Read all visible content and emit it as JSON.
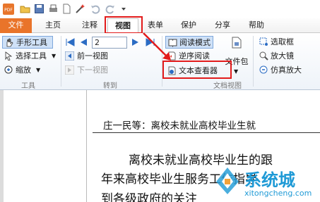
{
  "qat": {
    "icons": [
      "pdf-logo-icon",
      "open-folder-icon",
      "save-icon",
      "print-icon",
      "new-doc-icon",
      "magic-icon",
      "undo-icon",
      "redo-icon",
      "customize-dropdown-icon"
    ]
  },
  "tabs": [
    {
      "label": "文件"
    },
    {
      "label": "主页"
    },
    {
      "label": "注释"
    },
    {
      "label": "视图"
    },
    {
      "label": "表单"
    },
    {
      "label": "保护"
    },
    {
      "label": "分享"
    },
    {
      "label": "帮助"
    }
  ],
  "ribbon": {
    "tools": {
      "hand": "手形工具",
      "select": "选择工具",
      "zoom": "缩放",
      "group": "工具"
    },
    "goto": {
      "page_value": "2",
      "prev_view": "前一视图",
      "next_view": "下一视图",
      "group": "转到"
    },
    "docview": {
      "read_mode": "阅读模式",
      "reverse_read": "逆序阅读",
      "text_viewer": "文本查看器",
      "file_pkg": "文件包",
      "group": "文档视图"
    },
    "assist": {
      "select_box": "选取框",
      "magnifier": "放大镜",
      "sim_zoom": "仿真放大"
    }
  },
  "document": {
    "header": "庄一民等：离校未就业高校毕业生就",
    "para_line1": "离校未就业高校毕业生的跟",
    "para_line2": "年来高校毕业生服务工作指导",
    "para_line3": "到各级政府的关注"
  },
  "watermark": {
    "cn": "系统城",
    "url": "xitongcheng.com"
  },
  "colors": {
    "file_tab": "#e9742a",
    "highlight_red": "#e21b1b",
    "accent_blue": "#2b6cc4"
  }
}
